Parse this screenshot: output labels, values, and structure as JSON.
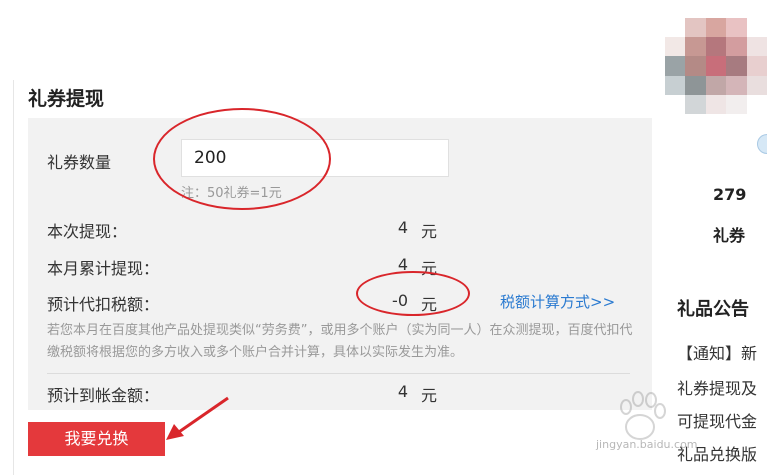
{
  "section_title": "礼券提现",
  "form": {
    "quantity_label": "礼券数量",
    "quantity_value": "200",
    "note": "注：50礼券=1元",
    "withdraw_label": "本次提现：",
    "withdraw_value": "4",
    "monthly_label": "本月累计提现：",
    "monthly_value": "4",
    "tax_label": "预计代扣税额：",
    "tax_value": "-0",
    "tax_link": "税额计算方式>>",
    "description": "若您本月在百度其他产品处提现类似“劳务费”，或用多个账户（实为同一人）在众测提现，百度代扣代缴税额将根据您的多方收入或多个账户合并计算，具体以实际发生为准。",
    "arrival_label": "预计到帐金额：",
    "arrival_value": "4",
    "unit": "元"
  },
  "redeem_button": "我要兑换",
  "sidebar": {
    "coupon_count": "279",
    "coupon_label": "礼券",
    "notice_title": "礼品公告",
    "notices": [
      "【通知】新",
      "礼券提现及",
      "可提现代金",
      "礼品兑换版"
    ]
  },
  "watermark": "jingyan.baidu.com",
  "colors": {
    "accent": "#e4393c",
    "link": "#2a7ad0",
    "annotation": "#d9262b"
  },
  "icons": [
    "blurred-avatar",
    "red-annotation-arrow",
    "baidu-paw-watermark"
  ]
}
